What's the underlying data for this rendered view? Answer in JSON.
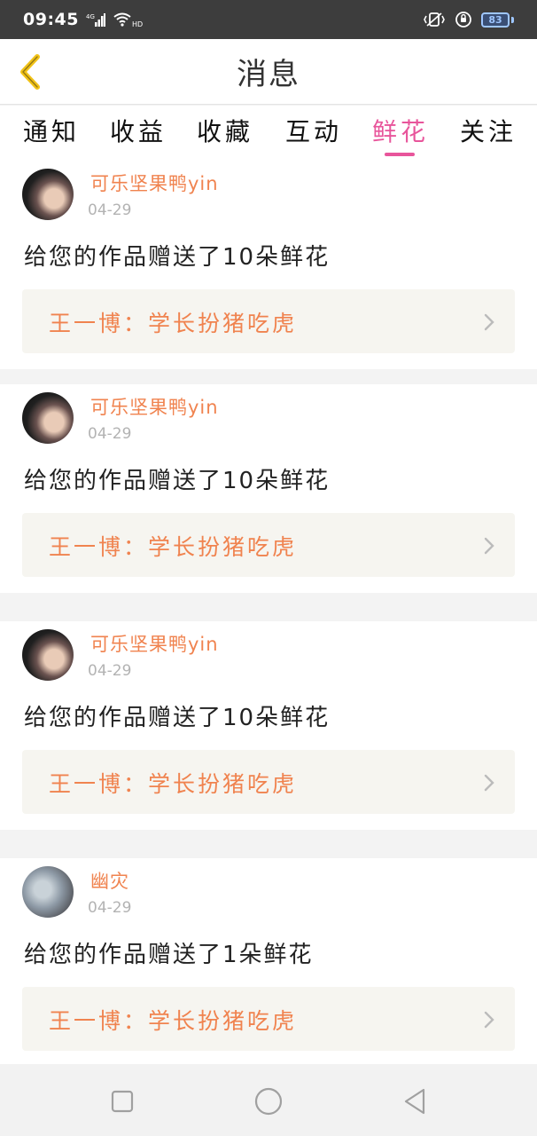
{
  "status_bar": {
    "time": "09:45",
    "network_label": "4G",
    "wifi_label": "HD",
    "battery_level": "83",
    "icons": [
      "signal-icon",
      "wifi-icon",
      "vibrate-icon",
      "alarm-icon",
      "battery-icon"
    ]
  },
  "nav": {
    "title": "消息",
    "back_icon": "chevron-left-icon"
  },
  "tabs": [
    {
      "label": "通知",
      "active": false
    },
    {
      "label": "收益",
      "active": false
    },
    {
      "label": "收藏",
      "active": false
    },
    {
      "label": "互动",
      "active": false
    },
    {
      "label": "鲜花",
      "active": true
    },
    {
      "label": "关注",
      "active": false
    }
  ],
  "messages": [
    {
      "username": "可乐坚果鸭yin",
      "date": "04-29",
      "text": "给您的作品赠送了10朵鲜花",
      "work_title": "王一博：学长扮猪吃虎"
    },
    {
      "username": "可乐坚果鸭yin",
      "date": "04-29",
      "text": "给您的作品赠送了10朵鲜花",
      "work_title": "王一博：学长扮猪吃虎"
    },
    {
      "username": "可乐坚果鸭yin",
      "date": "04-29",
      "text": "给您的作品赠送了10朵鲜花",
      "work_title": "王一博：学长扮猪吃虎"
    },
    {
      "username": "幽灾",
      "date": "04-29",
      "text": "给您的作品赠送了1朵鲜花",
      "work_title": "王一博：学长扮猪吃虎"
    }
  ],
  "colors": {
    "accent_pink": "#e8559b",
    "accent_orange": "#f0834f",
    "back_arrow": "#f2c318"
  }
}
